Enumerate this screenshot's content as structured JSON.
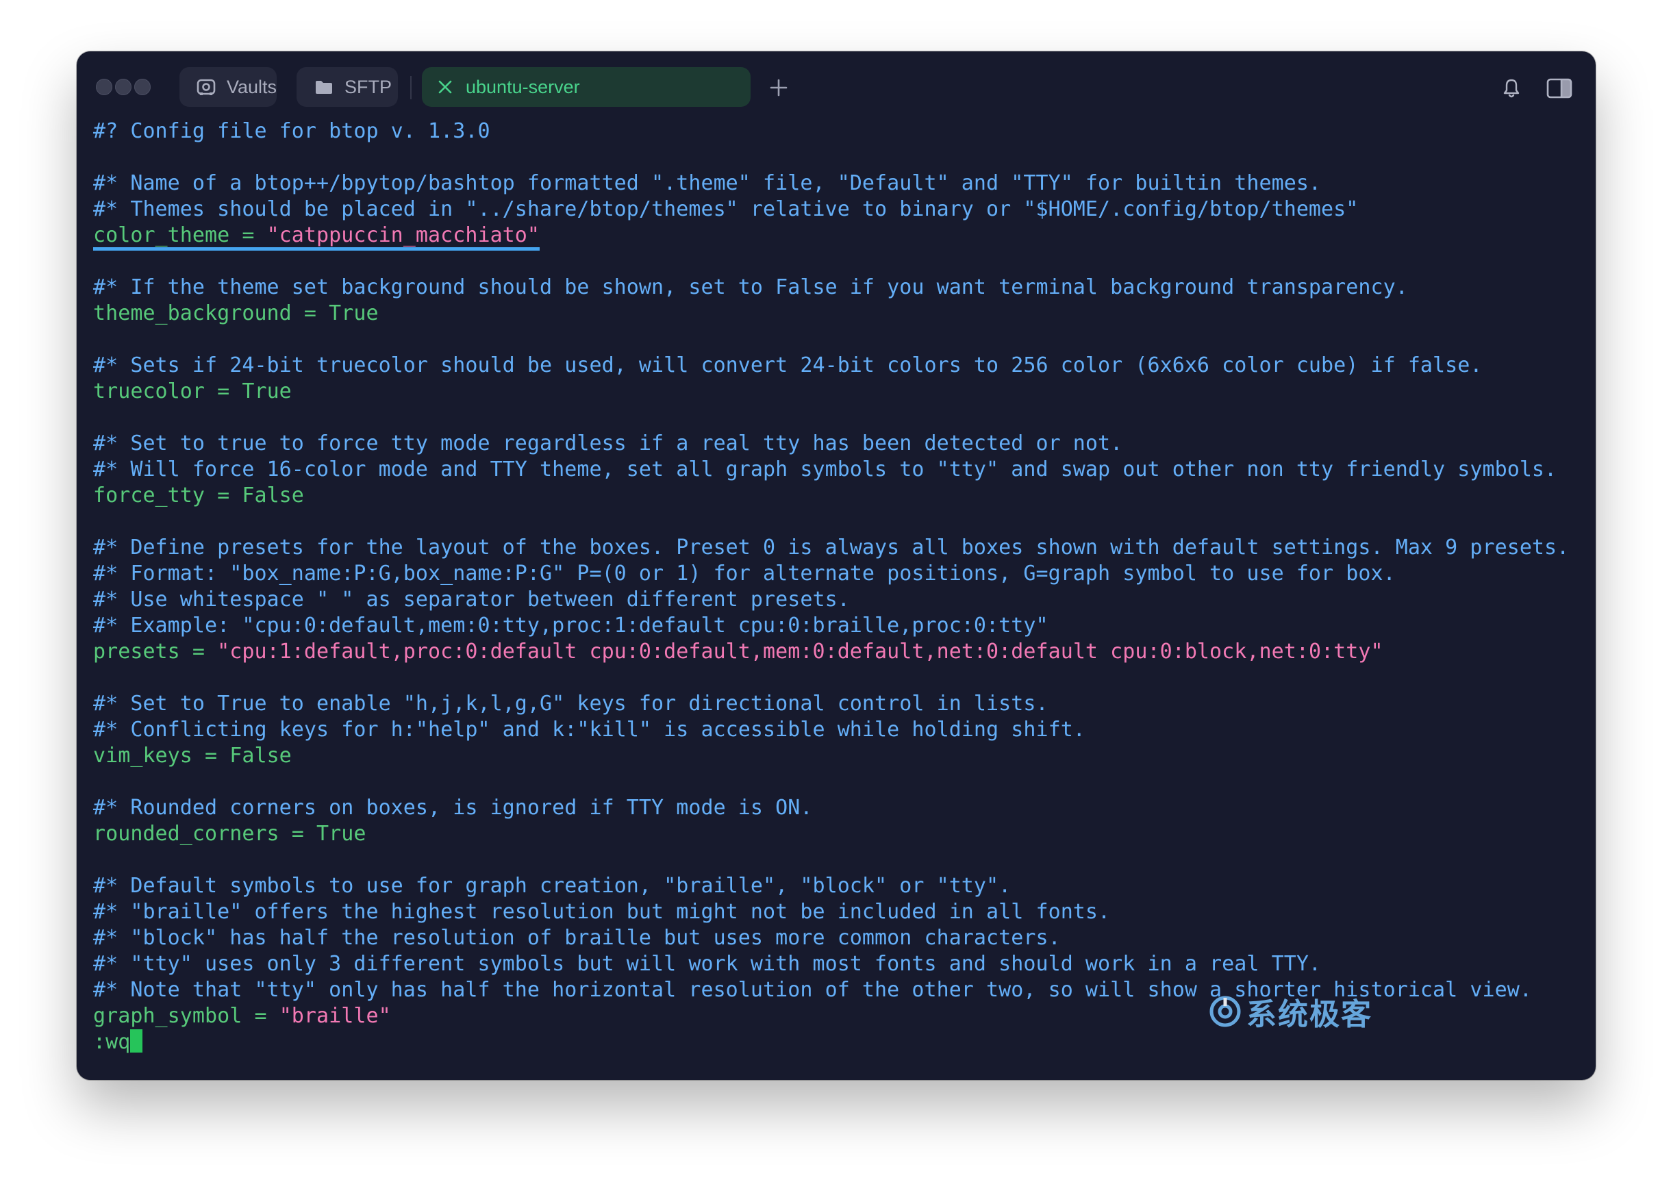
{
  "titlebar": {
    "tabs": [
      {
        "label": "Vaults",
        "icon": "vault-icon"
      },
      {
        "label": "SFTP",
        "icon": "folder-icon"
      },
      {
        "label": "ubuntu-server",
        "icon": "close-icon",
        "active": true
      }
    ],
    "new_tab_icon": "plus-icon",
    "notifications_icon": "bell-icon",
    "panel_icon": "sidebar-toggle-icon"
  },
  "colors": {
    "background": "#171a2d",
    "comment": "#64aef7",
    "key": "#57c97a",
    "string": "#f279b4",
    "active_tab": "#49d48c",
    "cursor": "#26c45a",
    "highlight_underline": "#45a5f0"
  },
  "terminal": {
    "lines": [
      {
        "t": "comment",
        "text": "#? Config file for btop v. 1.3.0"
      },
      {
        "t": "blank",
        "text": ""
      },
      {
        "t": "comment",
        "text": "#* Name of a btop++/bpytop/bashtop formatted \".theme\" file, \"Default\" and \"TTY\" for builtin themes."
      },
      {
        "t": "comment",
        "text": "#* Themes should be placed in \"../share/btop/themes\" relative to binary or \"$HOME/.config/btop/themes\""
      },
      {
        "t": "setting",
        "key": "color_theme = ",
        "value": "\"catppuccin_macchiato\"",
        "vtype": "string",
        "highlight": true
      },
      {
        "t": "blank",
        "text": ""
      },
      {
        "t": "comment",
        "text": "#* If the theme set background should be shown, set to False if you want terminal background transparency."
      },
      {
        "t": "setting",
        "key": "theme_background = ",
        "value": "True",
        "vtype": "plain"
      },
      {
        "t": "blank",
        "text": ""
      },
      {
        "t": "comment",
        "text": "#* Sets if 24-bit truecolor should be used, will convert 24-bit colors to 256 color (6x6x6 color cube) if false."
      },
      {
        "t": "setting",
        "key": "truecolor = ",
        "value": "True",
        "vtype": "plain"
      },
      {
        "t": "blank",
        "text": ""
      },
      {
        "t": "comment",
        "text": "#* Set to true to force tty mode regardless if a real tty has been detected or not."
      },
      {
        "t": "comment",
        "text": "#* Will force 16-color mode and TTY theme, set all graph symbols to \"tty\" and swap out other non tty friendly symbols."
      },
      {
        "t": "setting",
        "key": "force_tty = ",
        "value": "False",
        "vtype": "plain"
      },
      {
        "t": "blank",
        "text": ""
      },
      {
        "t": "comment",
        "text": "#* Define presets for the layout of the boxes. Preset 0 is always all boxes shown with default settings. Max 9 presets."
      },
      {
        "t": "comment",
        "text": "#* Format: \"box_name:P:G,box_name:P:G\" P=(0 or 1) for alternate positions, G=graph symbol to use for box."
      },
      {
        "t": "comment",
        "text": "#* Use whitespace \" \" as separator between different presets."
      },
      {
        "t": "comment",
        "text": "#* Example: \"cpu:0:default,mem:0:tty,proc:1:default cpu:0:braille,proc:0:tty\""
      },
      {
        "t": "setting",
        "key": "presets = ",
        "value": "\"cpu:1:default,proc:0:default cpu:0:default,mem:0:default,net:0:default cpu:0:block,net:0:tty\"",
        "vtype": "string"
      },
      {
        "t": "blank",
        "text": ""
      },
      {
        "t": "comment",
        "text": "#* Set to True to enable \"h,j,k,l,g,G\" keys for directional control in lists."
      },
      {
        "t": "comment",
        "text": "#* Conflicting keys for h:\"help\" and k:\"kill\" is accessible while holding shift."
      },
      {
        "t": "setting",
        "key": "vim_keys = ",
        "value": "False",
        "vtype": "plain"
      },
      {
        "t": "blank",
        "text": ""
      },
      {
        "t": "comment",
        "text": "#* Rounded corners on boxes, is ignored if TTY mode is ON."
      },
      {
        "t": "setting",
        "key": "rounded_corners = ",
        "value": "True",
        "vtype": "plain"
      },
      {
        "t": "blank",
        "text": ""
      },
      {
        "t": "comment",
        "text": "#* Default symbols to use for graph creation, \"braille\", \"block\" or \"tty\"."
      },
      {
        "t": "comment",
        "text": "#* \"braille\" offers the highest resolution but might not be included in all fonts."
      },
      {
        "t": "comment",
        "text": "#* \"block\" has half the resolution of braille but uses more common characters."
      },
      {
        "t": "comment",
        "text": "#* \"tty\" uses only 3 different symbols but will work with most fonts and should work in a real TTY."
      },
      {
        "t": "comment",
        "text": "#* Note that \"tty\" only has half the horizontal resolution of the other two, so will show a shorter historical view."
      },
      {
        "t": "setting",
        "key": "graph_symbol = ",
        "value": "\"braille\"",
        "vtype": "string"
      },
      {
        "t": "command",
        "text": ":wq"
      }
    ]
  },
  "watermark": {
    "text": "系统极客",
    "icon": "watermark-logo-icon"
  }
}
